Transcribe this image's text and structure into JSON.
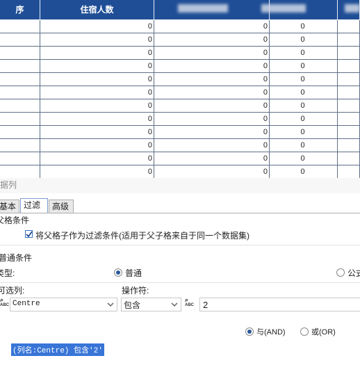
{
  "table": {
    "headers": [
      "住宿人数"
    ],
    "rows": [
      {
        "c1": "0",
        "c2": "0",
        "c3": "0"
      },
      {
        "c1": "0",
        "c2": "0",
        "c3": "0"
      },
      {
        "c1": "0",
        "c2": "0",
        "c3": "0"
      },
      {
        "c1": "0",
        "c2": "0",
        "c3": "0"
      },
      {
        "c1": "0",
        "c2": "0",
        "c3": "0"
      },
      {
        "c1": "0",
        "c2": "0",
        "c3": "0"
      },
      {
        "c1": "0",
        "c2": "0",
        "c3": "0"
      },
      {
        "c1": "0",
        "c2": "0",
        "c3": "0"
      },
      {
        "c1": "0",
        "c2": "0",
        "c3": "0"
      },
      {
        "c1": "0",
        "c2": "0",
        "c3": "0"
      },
      {
        "c1": "0",
        "c2": "0",
        "c3": "0"
      },
      {
        "c1": "0",
        "c2": "0",
        "c3": "0"
      }
    ],
    "header_color": "#1f4e96"
  },
  "panel": {
    "title": "据列",
    "tabs": [
      "基本",
      "过滤",
      "高级"
    ],
    "active_tab": "过滤",
    "parent_section": "父格条件",
    "parent_checkbox_label": "将父格子作为过滤条件(适用于父子格来自于同一个数据集)",
    "parent_checkbox_checked": true,
    "normal_section": "普通条件",
    "type_label": "类型:",
    "type_options": [
      "普通",
      "公式"
    ],
    "type_selected": "普通",
    "column_label": "可选列:",
    "column_value": "Centre",
    "operator_label": "操作符:",
    "operator_value": "包含",
    "value_input": "2",
    "logic_options": [
      "与(AND)",
      "或(OR)"
    ],
    "logic_selected": "与(AND)",
    "expression": "(列名:Centre) 包含'2'"
  }
}
